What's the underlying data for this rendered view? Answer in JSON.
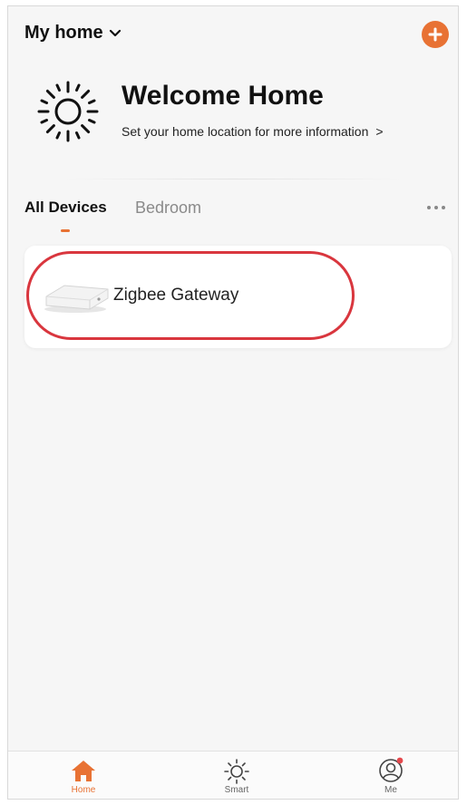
{
  "header": {
    "home_name": "My home",
    "add_icon": "plus-circle-icon"
  },
  "welcome": {
    "title": "Welcome Home",
    "subtitle": "Set your home location for more information",
    "arrow": ">",
    "icon": "sun-icon"
  },
  "tabs": [
    {
      "label": "All Devices",
      "active": true
    },
    {
      "label": "Bedroom",
      "active": false
    }
  ],
  "devices": [
    {
      "name": "Zigbee Gateway",
      "icon": "gateway-device-image",
      "highlighted": true
    }
  ],
  "bottom_nav": [
    {
      "label": "Home",
      "icon": "home-icon",
      "active": true
    },
    {
      "label": "Smart",
      "icon": "sun-icon",
      "active": false
    },
    {
      "label": "Me",
      "icon": "profile-icon",
      "active": false,
      "badge": true
    }
  ],
  "colors": {
    "accent": "#e87234",
    "highlight_ring": "#d9363e",
    "background": "#f6f6f6",
    "inactive_text": "#8a8a8a"
  }
}
